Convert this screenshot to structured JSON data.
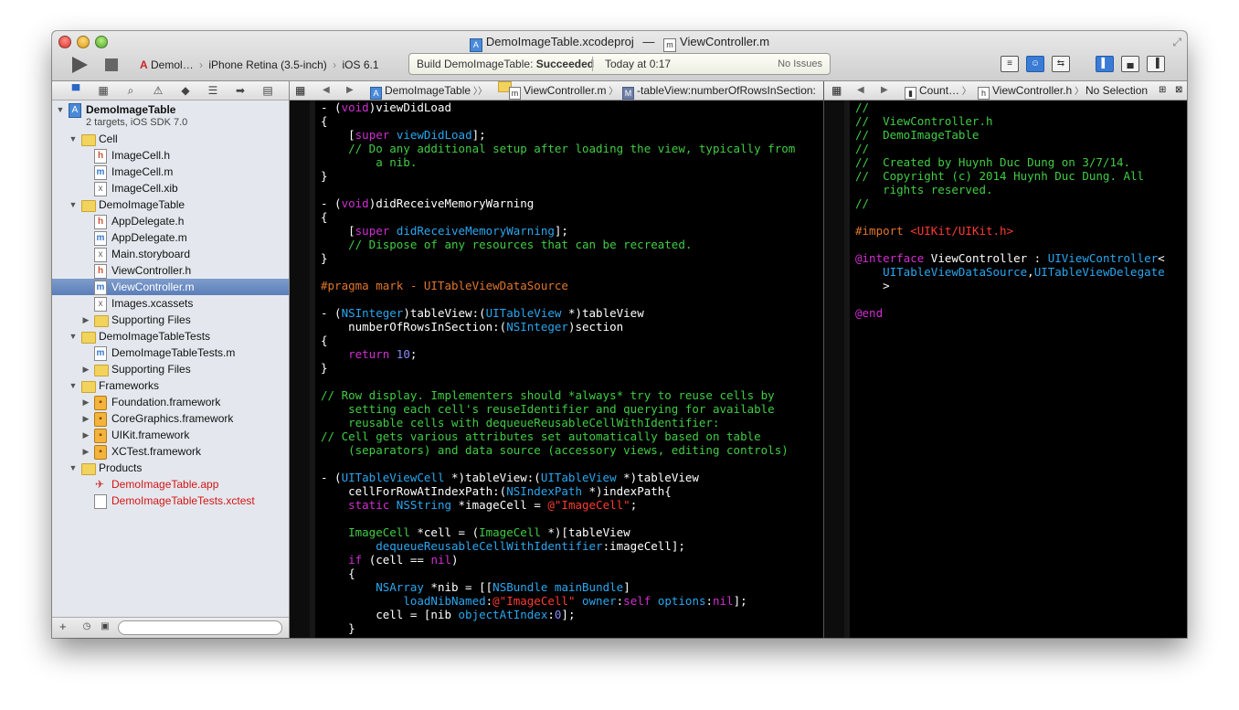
{
  "window": {
    "project_file": "DemoImageTable.xcodeproj",
    "separator": "—",
    "current_file": "ViewController.m"
  },
  "toolbar": {
    "scheme": "Demol…",
    "destination": "iPhone Retina (3.5-inch)",
    "sdk": "iOS 6.1",
    "activity_prefix": "Build DemoImageTable:",
    "activity_status": "Succeeded",
    "activity_time": "Today at 0:17",
    "activity_issues": "No Issues"
  },
  "navigator": {
    "items": [
      {
        "label": "DemoImageTable",
        "sub": "2 targets, iOS SDK 7.0",
        "indent": 0,
        "type": "project",
        "open": true
      },
      {
        "label": "Cell",
        "indent": 1,
        "type": "folder",
        "open": true
      },
      {
        "label": "ImageCell.h",
        "indent": 2,
        "type": "h"
      },
      {
        "label": "ImageCell.m",
        "indent": 2,
        "type": "m"
      },
      {
        "label": "ImageCell.xib",
        "indent": 2,
        "type": "xib"
      },
      {
        "label": "DemoImageTable",
        "indent": 1,
        "type": "folder",
        "open": true
      },
      {
        "label": "AppDelegate.h",
        "indent": 2,
        "type": "h"
      },
      {
        "label": "AppDelegate.m",
        "indent": 2,
        "type": "m"
      },
      {
        "label": "Main.storyboard",
        "indent": 2,
        "type": "xib"
      },
      {
        "label": "ViewController.h",
        "indent": 2,
        "type": "h"
      },
      {
        "label": "ViewController.m",
        "indent": 2,
        "type": "m",
        "selected": true
      },
      {
        "label": "Images.xcassets",
        "indent": 2,
        "type": "xib"
      },
      {
        "label": "Supporting Files",
        "indent": 2,
        "type": "folder",
        "open": false
      },
      {
        "label": "DemoImageTableTests",
        "indent": 1,
        "type": "folder",
        "open": true
      },
      {
        "label": "DemoImageTableTests.m",
        "indent": 2,
        "type": "m"
      },
      {
        "label": "Supporting Files",
        "indent": 2,
        "type": "folder",
        "open": false
      },
      {
        "label": "Frameworks",
        "indent": 1,
        "type": "folder",
        "open": true
      },
      {
        "label": "Foundation.framework",
        "indent": 2,
        "type": "framework",
        "open": false
      },
      {
        "label": "CoreGraphics.framework",
        "indent": 2,
        "type": "framework",
        "open": false
      },
      {
        "label": "UIKit.framework",
        "indent": 2,
        "type": "framework",
        "open": false
      },
      {
        "label": "XCTest.framework",
        "indent": 2,
        "type": "framework",
        "open": false
      },
      {
        "label": "Products",
        "indent": 1,
        "type": "folder",
        "open": true
      },
      {
        "label": "DemoImageTable.app",
        "indent": 2,
        "type": "app",
        "missing": true
      },
      {
        "label": "DemoImageTableTests.xctest",
        "indent": 2,
        "type": "xctest",
        "missing": true
      }
    ]
  },
  "jump_main": {
    "project": "DemoImageTable",
    "file": "ViewController.m",
    "method": "-tableView:numberOfRowsInSection:"
  },
  "jump_assistant": {
    "mode": "Count…",
    "file": "ViewController.h",
    "selection": "No Selection"
  },
  "colors": {
    "keyword": "#d12ed1",
    "type": "#29a7f0",
    "comment": "#41cc45",
    "string": "#ff3a32",
    "number": "#8a8af5",
    "pragma": "#e1762b"
  },
  "code_main": [
    [
      [
        "p",
        "- ("
      ],
      [
        "k",
        "void"
      ],
      [
        "p",
        ")viewDidLoad"
      ]
    ],
    [
      [
        "p",
        "{"
      ]
    ],
    [
      [
        "p",
        "    ["
      ],
      [
        "k",
        "super"
      ],
      [
        "p",
        " "
      ],
      [
        "t",
        "viewDidLoad"
      ],
      [
        "p",
        "];"
      ]
    ],
    [
      [
        "c",
        "    // Do any additional setup after loading the view, typically from"
      ]
    ],
    [
      [
        "c",
        "        a nib."
      ]
    ],
    [
      [
        "p",
        "}"
      ]
    ],
    [
      [
        "p",
        ""
      ]
    ],
    [
      [
        "p",
        "- ("
      ],
      [
        "k",
        "void"
      ],
      [
        "p",
        ")didReceiveMemoryWarning"
      ]
    ],
    [
      [
        "p",
        "{"
      ]
    ],
    [
      [
        "p",
        "    ["
      ],
      [
        "k",
        "super"
      ],
      [
        "p",
        " "
      ],
      [
        "t",
        "didReceiveMemoryWarning"
      ],
      [
        "p",
        "];"
      ]
    ],
    [
      [
        "c",
        "    // Dispose of any resources that can be recreated."
      ]
    ],
    [
      [
        "p",
        "}"
      ]
    ],
    [
      [
        "p",
        ""
      ]
    ],
    [
      [
        "o",
        "#pragma mark - UITableViewDataSource"
      ]
    ],
    [
      [
        "p",
        ""
      ]
    ],
    [
      [
        "p",
        "- ("
      ],
      [
        "t",
        "NSInteger"
      ],
      [
        "p",
        ")tableView:("
      ],
      [
        "t",
        "UITableView"
      ],
      [
        "p",
        " *)tableView"
      ]
    ],
    [
      [
        "p",
        "    numberOfRowsInSection:("
      ],
      [
        "t",
        "NSInteger"
      ],
      [
        "p",
        ")section"
      ]
    ],
    [
      [
        "p",
        "{"
      ]
    ],
    [
      [
        "p",
        "    "
      ],
      [
        "k",
        "return"
      ],
      [
        "p",
        " "
      ],
      [
        "n",
        "10"
      ],
      [
        "p",
        ";"
      ]
    ],
    [
      [
        "p",
        "}"
      ]
    ],
    [
      [
        "p",
        ""
      ]
    ],
    [
      [
        "c",
        "// Row display. Implementers should *always* try to reuse cells by"
      ]
    ],
    [
      [
        "c",
        "    setting each cell's reuseIdentifier and querying for available"
      ]
    ],
    [
      [
        "c",
        "    reusable cells with dequeueReusableCellWithIdentifier:"
      ]
    ],
    [
      [
        "c",
        "// Cell gets various attributes set automatically based on table"
      ]
    ],
    [
      [
        "c",
        "    (separators) and data source (accessory views, editing controls)"
      ]
    ],
    [
      [
        "p",
        ""
      ]
    ],
    [
      [
        "p",
        "- ("
      ],
      [
        "t",
        "UITableViewCell"
      ],
      [
        "p",
        " *)tableView:("
      ],
      [
        "t",
        "UITableView"
      ],
      [
        "p",
        " *)tableView"
      ]
    ],
    [
      [
        "p",
        "    cellForRowAtIndexPath:("
      ],
      [
        "t",
        "NSIndexPath"
      ],
      [
        "p",
        " *)indexPath{"
      ]
    ],
    [
      [
        "p",
        "    "
      ],
      [
        "k",
        "static"
      ],
      [
        "p",
        " "
      ],
      [
        "t",
        "NSString"
      ],
      [
        "p",
        " *imageCell = "
      ],
      [
        "s",
        "@\"ImageCell\""
      ],
      [
        "p",
        ";"
      ]
    ],
    [
      [
        "p",
        ""
      ]
    ],
    [
      [
        "p",
        "    "
      ],
      [
        "g",
        "ImageCell"
      ],
      [
        "p",
        " *cell = ("
      ],
      [
        "g",
        "ImageCell"
      ],
      [
        "p",
        " *)[tableView"
      ]
    ],
    [
      [
        "p",
        "        "
      ],
      [
        "t",
        "dequeueReusableCellWithIdentifier"
      ],
      [
        "p",
        ":imageCell];"
      ]
    ],
    [
      [
        "p",
        "    "
      ],
      [
        "k",
        "if"
      ],
      [
        "p",
        " (cell == "
      ],
      [
        "k",
        "nil"
      ],
      [
        "p",
        ")"
      ]
    ],
    [
      [
        "p",
        "    {"
      ]
    ],
    [
      [
        "p",
        "        "
      ],
      [
        "t",
        "NSArray"
      ],
      [
        "p",
        " *nib = [["
      ],
      [
        "t",
        "NSBundle"
      ],
      [
        "p",
        " "
      ],
      [
        "t",
        "mainBundle"
      ],
      [
        "p",
        "]"
      ]
    ],
    [
      [
        "p",
        "            "
      ],
      [
        "t",
        "loadNibNamed"
      ],
      [
        "p",
        ":"
      ],
      [
        "s",
        "@\"ImageCell\""
      ],
      [
        "p",
        " "
      ],
      [
        "t",
        "owner"
      ],
      [
        "p",
        ":"
      ],
      [
        "k",
        "self"
      ],
      [
        "p",
        " "
      ],
      [
        "t",
        "options"
      ],
      [
        "p",
        ":"
      ],
      [
        "k",
        "nil"
      ],
      [
        "p",
        "];"
      ]
    ],
    [
      [
        "p",
        "        cell = [nib "
      ],
      [
        "t",
        "objectAtIndex"
      ],
      [
        "p",
        ":"
      ],
      [
        "n",
        "0"
      ],
      [
        "p",
        "];"
      ]
    ],
    [
      [
        "p",
        "    }"
      ]
    ]
  ],
  "code_assistant": [
    [
      [
        "c",
        "//"
      ]
    ],
    [
      [
        "c",
        "//  ViewController.h"
      ]
    ],
    [
      [
        "c",
        "//  DemoImageTable"
      ]
    ],
    [
      [
        "c",
        "//"
      ]
    ],
    [
      [
        "c",
        "//  Created by Huynh Duc Dung on 3/7/14."
      ]
    ],
    [
      [
        "c",
        "//  Copyright (c) 2014 Huynh Duc Dung. All"
      ]
    ],
    [
      [
        "c",
        "    rights reserved."
      ]
    ],
    [
      [
        "c",
        "//"
      ]
    ],
    [
      [
        "p",
        ""
      ]
    ],
    [
      [
        "o",
        "#import "
      ],
      [
        "s",
        "<UIKit/UIKit.h>"
      ]
    ],
    [
      [
        "p",
        ""
      ]
    ],
    [
      [
        "k",
        "@interface"
      ],
      [
        "p",
        " ViewController : "
      ],
      [
        "t",
        "UIViewController"
      ],
      [
        "p",
        "<"
      ]
    ],
    [
      [
        "p",
        "    "
      ],
      [
        "t",
        "UITableViewDataSource"
      ],
      [
        "p",
        ","
      ],
      [
        "t",
        "UITableViewDelegate"
      ]
    ],
    [
      [
        "p",
        "    >"
      ]
    ],
    [
      [
        "p",
        ""
      ]
    ],
    [
      [
        "k",
        "@end"
      ]
    ]
  ]
}
